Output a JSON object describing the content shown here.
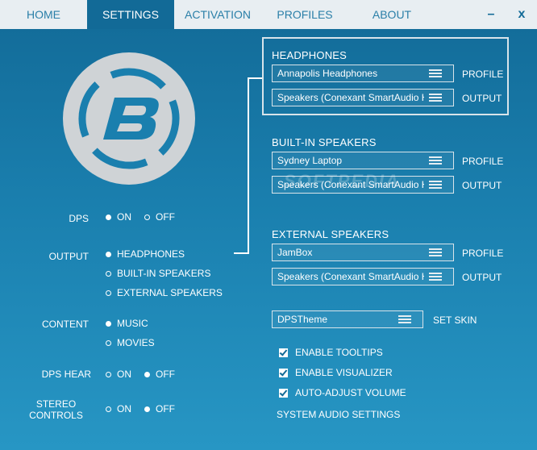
{
  "tabs": [
    {
      "label": "HOME"
    },
    {
      "label": "SETTINGS"
    },
    {
      "label": "ACTIVATION"
    },
    {
      "label": "PROFILES"
    },
    {
      "label": "ABOUT"
    }
  ],
  "window": {
    "minimize": "–",
    "close": "x"
  },
  "logo": {
    "icon": "bongiovi-b-logo-icon"
  },
  "settings": {
    "dps": {
      "label": "DPS",
      "options": [
        "ON",
        "OFF"
      ],
      "selected": "ON"
    },
    "output": {
      "label": "OUTPUT",
      "options": [
        "HEADPHONES",
        "BUILT-IN SPEAKERS",
        "EXTERNAL SPEAKERS"
      ],
      "selected": "HEADPHONES"
    },
    "content": {
      "label": "CONTENT",
      "options": [
        "MUSIC",
        "MOVIES"
      ],
      "selected": "MUSIC"
    },
    "dps_hear": {
      "label": "DPS HEAR",
      "options": [
        "ON",
        "OFF"
      ],
      "selected": "OFF"
    },
    "stereo_controls": {
      "label_line1": "STEREO",
      "label_line2": "CONTROLS",
      "options": [
        "ON",
        "OFF"
      ],
      "selected": "OFF"
    }
  },
  "devices": [
    {
      "title": "HEADPHONES",
      "profile": "Annapolis Headphones",
      "output": "Speakers (Conexant SmartAudio HD)",
      "profile_label": "PROFILE",
      "output_label": "OUTPUT"
    },
    {
      "title": "BUILT-IN SPEAKERS",
      "profile": "Sydney Laptop",
      "output": "Speakers (Conexant SmartAudio HD)",
      "profile_label": "PROFILE",
      "output_label": "OUTPUT"
    },
    {
      "title": "EXTERNAL SPEAKERS",
      "profile": "JamBox",
      "output": "Speakers (Conexant SmartAudio HD)",
      "profile_label": "PROFILE",
      "output_label": "OUTPUT"
    }
  ],
  "skin": {
    "value": "DPSTheme",
    "label": "SET SKIN"
  },
  "checkboxes": [
    {
      "label": "ENABLE TOOLTIPS",
      "checked": true
    },
    {
      "label": "ENABLE VISUALIZER",
      "checked": true
    },
    {
      "label": "AUTO-ADJUST VOLUME",
      "checked": true
    }
  ],
  "system_audio_link": "SYSTEM AUDIO SETTINGS",
  "watermark": "SOFTPEDIA",
  "colors": {
    "accent": "#126a97",
    "background_bottom": "#2796c4",
    "topbar": "#e8eef2"
  }
}
